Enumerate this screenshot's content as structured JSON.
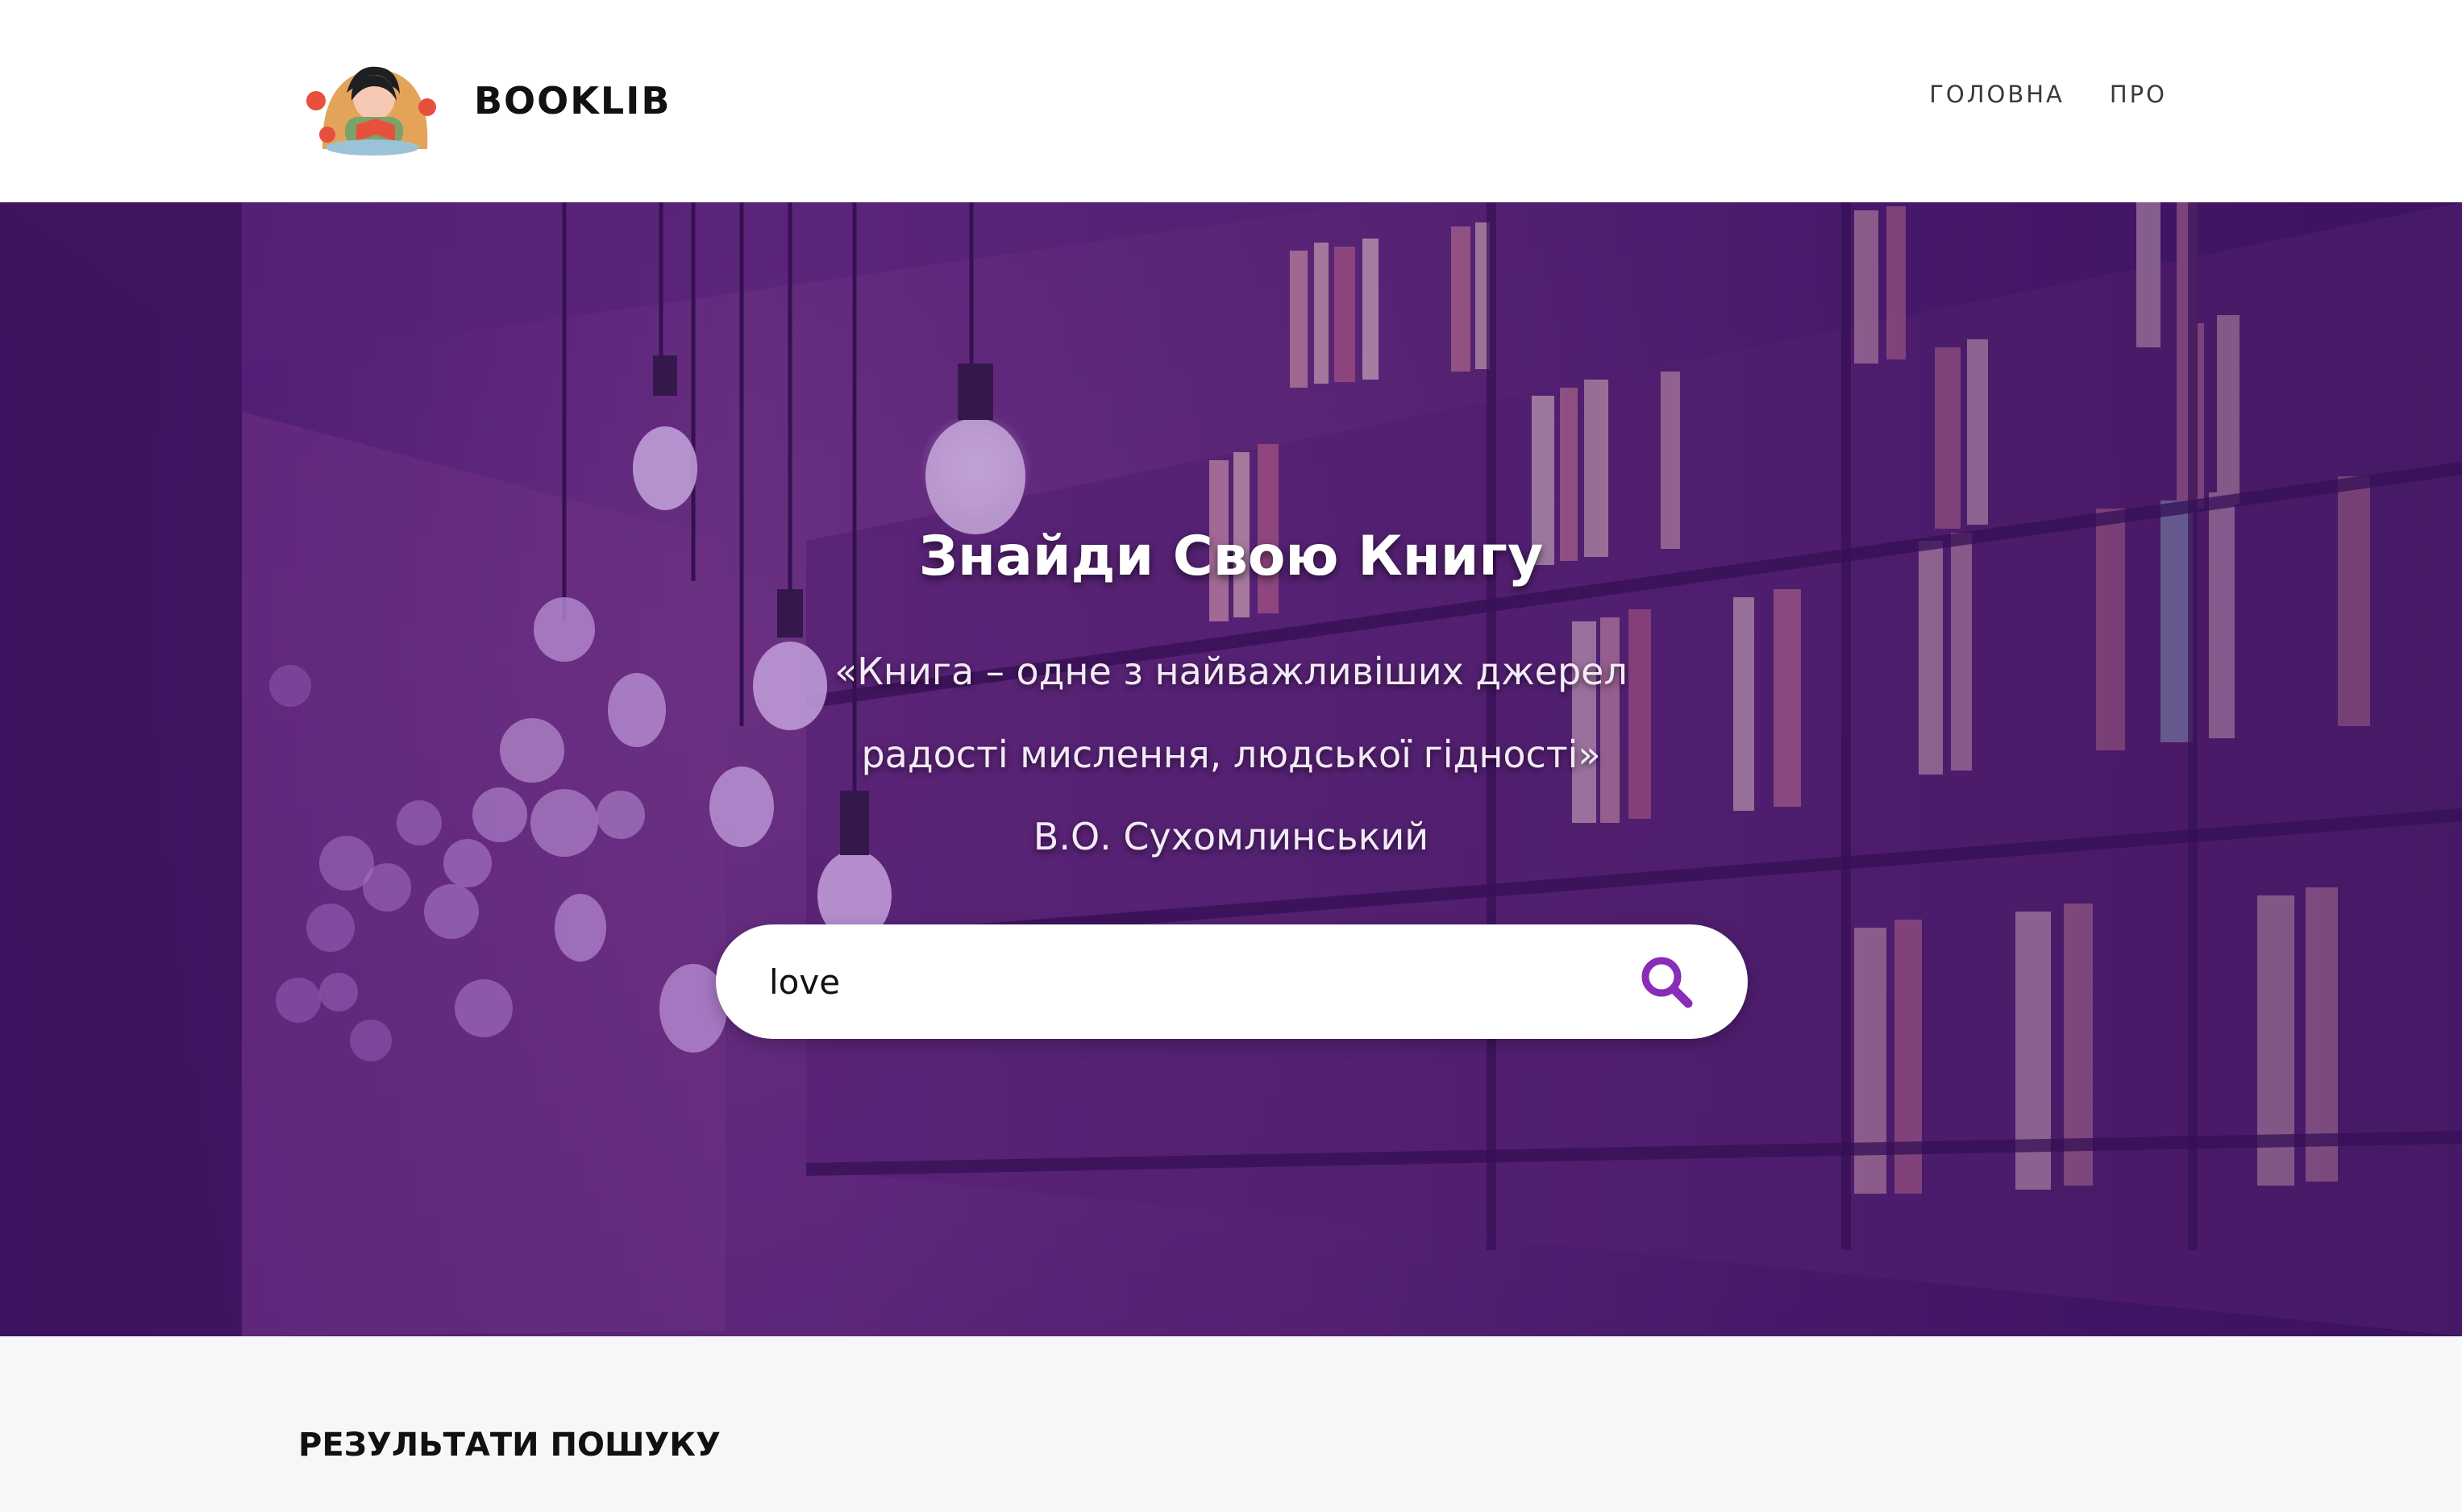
{
  "brand": {
    "name": "BOOKLIB",
    "logo_icon": "reading-girl-logo-icon"
  },
  "nav": {
    "items": [
      {
        "label": "ГОЛОВНА"
      },
      {
        "label": "ПРО"
      }
    ]
  },
  "hero": {
    "title": "Знайди Свою Книгу",
    "quote_line1": "«Книга – одне з найважливіших джерел",
    "quote_line2": "радості мислення, людської гідності»",
    "quote_author": "В.О. Сухомлинський",
    "background_image": "library-bookshelves-with-hanging-light-bulbs"
  },
  "search": {
    "value": "love",
    "button_icon": "search-icon",
    "accent_color": "#8a2cb8"
  },
  "results": {
    "title": "РЕЗУЛЬТАТИ ПОШУКУ"
  }
}
